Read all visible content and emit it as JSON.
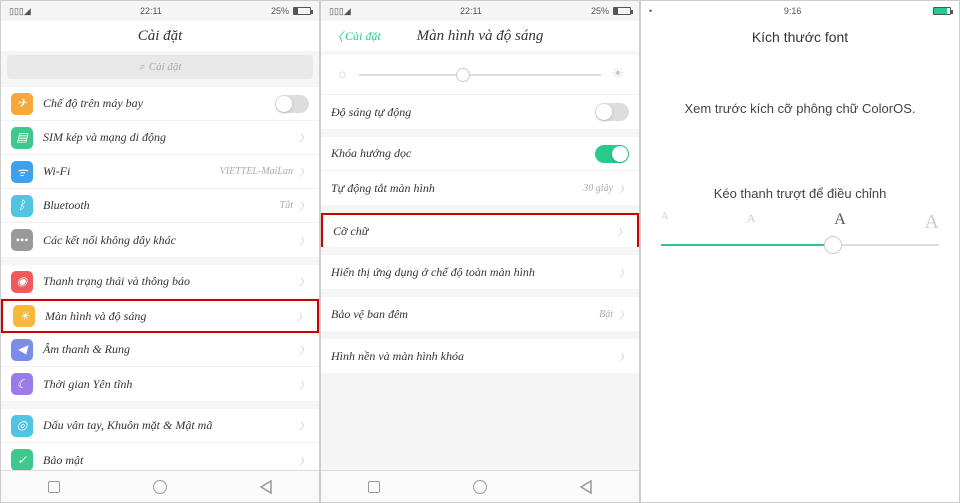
{
  "phone1": {
    "status": {
      "time": "22:11",
      "battery": "25%"
    },
    "title": "Cài đặt",
    "search_placeholder": "Cài đặt",
    "groups": [
      {
        "rows": [
          {
            "icon": "airplane",
            "color": "#f7a83b",
            "label": "Chế độ trên máy bay",
            "toggle": "off"
          },
          {
            "icon": "sim",
            "color": "#3dc98e",
            "label": "SIM kép và mạng di động",
            "chevron": true
          },
          {
            "icon": "wifi",
            "color": "#3ea1f0",
            "label": "Wi-Fi",
            "value": "VIETTEL-MaiLan",
            "chevron": true
          },
          {
            "icon": "bluetooth",
            "color": "#50c4e0",
            "label": "Bluetooth",
            "value": "Tắt",
            "chevron": true
          },
          {
            "icon": "more",
            "color": "#999",
            "label": "Các kết nối không dây khác",
            "chevron": true
          }
        ]
      },
      {
        "rows": [
          {
            "icon": "bell",
            "color": "#f05a5a",
            "label": "Thanh trạng thái và thông báo",
            "chevron": true
          },
          {
            "icon": "display",
            "color": "#f7b83b",
            "label": "Màn hình và độ sáng",
            "chevron": true,
            "highlighted": true
          },
          {
            "icon": "sound",
            "color": "#7b8de8",
            "label": "Âm thanh & Rung",
            "chevron": true
          },
          {
            "icon": "moon",
            "color": "#9b7be8",
            "label": "Thời gian Yên tĩnh",
            "chevron": true
          }
        ]
      },
      {
        "rows": [
          {
            "icon": "fingerprint",
            "color": "#50c4e0",
            "label": "Dấu vân tay, Khuôn mặt & Mật mã",
            "chevron": true
          },
          {
            "icon": "shield",
            "color": "#3dc98e",
            "label": "Bảo mật",
            "chevron": true
          }
        ]
      }
    ]
  },
  "phone2": {
    "status": {
      "time": "22:11",
      "battery": "25%"
    },
    "back": "Cài đặt",
    "title": "Màn hình và độ sáng",
    "rows": [
      {
        "type": "brightness"
      },
      {
        "label": "Độ sáng tự động",
        "toggle": "off"
      },
      {
        "type": "gap"
      },
      {
        "label": "Khóa hướng dọc",
        "toggle": "on"
      },
      {
        "label": "Tự động tắt màn hình",
        "value": "30 giây",
        "chevron": true
      },
      {
        "type": "gap"
      },
      {
        "label": "Cỡ chữ",
        "chevron": true,
        "highlighted": true
      },
      {
        "type": "gap"
      },
      {
        "label": "Hiển thị ứng dụng ở chế độ toàn màn hình",
        "chevron": true
      },
      {
        "type": "gap"
      },
      {
        "label": "Bảo vệ ban đêm",
        "value": "Bật",
        "chevron": true
      },
      {
        "type": "gap"
      },
      {
        "label": "Hình nền và màn hình khóa",
        "chevron": true
      }
    ]
  },
  "phone3": {
    "status": {
      "time": "9:16"
    },
    "title": "Kích thước font",
    "preview": "Xem trước kích cỡ phông chữ ColorOS.",
    "instructions": "Kéo thanh trượt để điều chỉnh",
    "marks": [
      "A",
      "A",
      "A",
      "A"
    ]
  }
}
